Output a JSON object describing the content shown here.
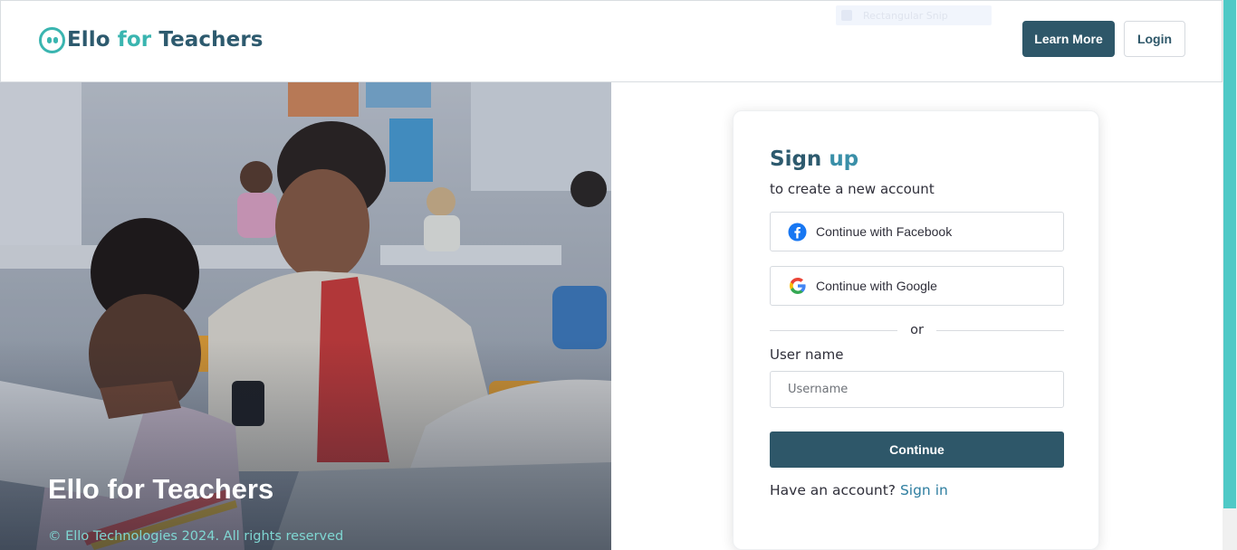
{
  "header": {
    "logo": {
      "ello": "Ello",
      "for": "for",
      "teachers": "Teachers"
    },
    "ghost_badge": "Rectangular Snip",
    "learn_more": "Learn More",
    "login": "Login"
  },
  "hero": {
    "title": "Ello for Teachers",
    "copyright": "© Ello Technologies 2024. All rights reserved"
  },
  "signup": {
    "title_sign": "Sign",
    "title_up": "up",
    "subtitle": "to create a new account",
    "facebook_label": "Continue with Facebook",
    "google_label": "Continue with Google",
    "divider_text": "or",
    "username_label": "User name",
    "username_placeholder": "Username",
    "username_value": "",
    "continue_label": "Continue",
    "have_account_text": "Have an account?",
    "signin_label": "Sign in"
  },
  "colors": {
    "brand_dark": "#2e5769",
    "brand_teal": "#3ab5b0",
    "link": "#2e7ea0",
    "facebook_blue": "#1877f2"
  },
  "icons": [
    "ello-logo-icon",
    "facebook-icon",
    "google-icon"
  ]
}
